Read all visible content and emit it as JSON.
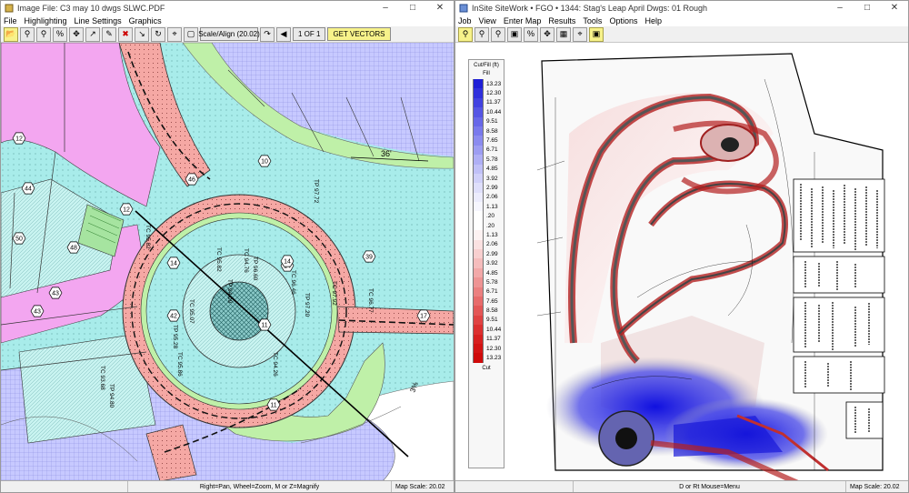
{
  "left": {
    "title": "Image File: C3 may 10 dwgs SLWC.PDF",
    "menu": [
      "File",
      "Highlighting",
      "Line Settings",
      "Graphics"
    ],
    "scale_button": "Scale/Align (20.02)",
    "page_button": "1 OF 1",
    "vectors_button": "GET VECTORS",
    "status_help": "Right=Pan, Wheel=Zoom, M or Z=Magnify",
    "status_scale": "Map Scale: 20.02"
  },
  "right": {
    "title": "InSite SiteWork • FGO • 1344: Stag's Leap April Dwgs: 01 Rough",
    "menu": [
      "Job",
      "View",
      "Enter Map",
      "Results",
      "Tools",
      "Options",
      "Help"
    ],
    "status_help": "D or Rt Mouse=Menu",
    "status_scale": "Map Scale: 20.02",
    "legend": {
      "title": "Cut/Fill (ft)",
      "fill_label": "Fill",
      "cut_label": "Cut",
      "values": [
        "13.23",
        "12.30",
        "11.37",
        "10.44",
        "9.51",
        "8.58",
        "7.65",
        "6.71",
        "5.78",
        "4.85",
        "3.92",
        "2.99",
        "2.06",
        "1.13",
        ".20",
        ".20",
        "1.13",
        "2.06",
        "2.99",
        "3.92",
        "4.85",
        "5.78",
        "6.71",
        "7.65",
        "8.58",
        "9.51",
        "10.44",
        "11.37",
        "12.30",
        "13.23"
      ],
      "colors": [
        "#1f1fd6",
        "#3030dc",
        "#4242e0",
        "#5555e4",
        "#6767e8",
        "#7979ec",
        "#8b8bef",
        "#9d9df2",
        "#afaff5",
        "#c0c0f7",
        "#d0d0f9",
        "#dfdffb",
        "#ececfd",
        "#f6f6fe",
        "#ffffff",
        "#ffffff",
        "#fdf2f2",
        "#fbe1e1",
        "#f8cfcf",
        "#f5bcbc",
        "#f2a8a8",
        "#ee9494",
        "#eb8080",
        "#e76b6b",
        "#e35757",
        "#df4343",
        "#db3030",
        "#d72020",
        "#d31414",
        "#cf0a0a"
      ]
    }
  },
  "map_labels": {
    "tc": [
      "TC 95.82",
      "TC 94.76",
      "TC 95.07",
      "TC 97.92",
      "TC 95.86",
      "TC 96.46",
      "TC 94.26",
      "TC 96.77",
      "TC 95.82",
      "TC 93.68"
    ],
    "tp": [
      "TP 94.09",
      "TP 96.60",
      "TP 97.72",
      "TP 95.28",
      "TP 97.20",
      "TP 94.80"
    ],
    "circles": [
      "12",
      "14",
      "12",
      "46",
      "43",
      "48",
      "50",
      "14",
      "14",
      "39",
      "42",
      "43",
      "44",
      "10",
      "11",
      "17",
      "11"
    ],
    "dim_36": "36'",
    "grade": "3%"
  }
}
